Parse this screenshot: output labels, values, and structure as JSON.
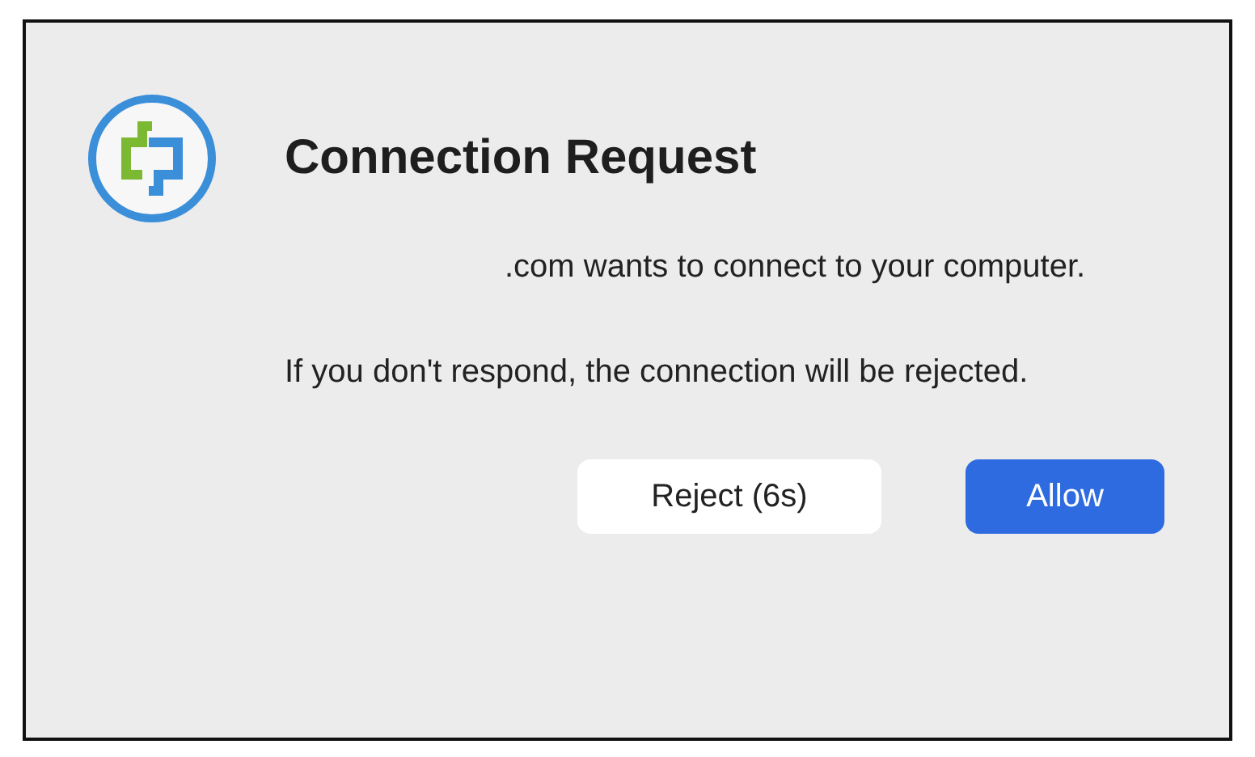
{
  "dialog": {
    "title": "Connection Request",
    "message": ".com wants to connect to your computer.",
    "note": "If you don't respond, the connection will be rejected.",
    "buttons": [
      {
        "label": "Reject (6s)",
        "kind": "secondary"
      },
      {
        "label": "Allow",
        "kind": "primary"
      }
    ]
  }
}
